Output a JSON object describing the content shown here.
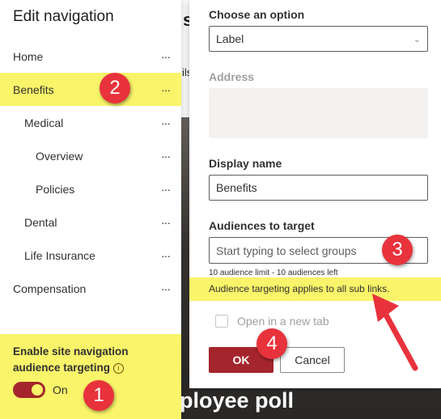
{
  "background": {
    "text_top": "sc",
    "text_mid": "ils",
    "text_bottom": "ployee poll"
  },
  "nav": {
    "title": "Edit navigation",
    "items": [
      {
        "label": "Home",
        "level": 0
      },
      {
        "label": "Benefits",
        "level": 0
      },
      {
        "label": "Medical",
        "level": 1
      },
      {
        "label": "Overview",
        "level": 2
      },
      {
        "label": "Policies",
        "level": 2
      },
      {
        "label": "Dental",
        "level": 1
      },
      {
        "label": "Life Insurance",
        "level": 1
      },
      {
        "label": "Compensation",
        "level": 0
      }
    ],
    "more": "···",
    "targeting_label": "Enable site navigation audience targeting",
    "info_icon": "i",
    "toggle_state": "On",
    "toggle_on": true
  },
  "panel": {
    "choose_label": "Choose an option",
    "choose_value": "Label",
    "address_label": "Address",
    "display_label": "Display name",
    "display_value": "Benefits",
    "audiences_label": "Audiences to target",
    "audiences_placeholder": "Start typing to select groups",
    "audience_limit": "10 audience limit - 10 audiences left",
    "note": "Audience targeting applies to all sub links.",
    "new_tab_label": "Open in a new tab",
    "ok": "OK",
    "cancel": "Cancel"
  },
  "badges": [
    "1",
    "2",
    "3",
    "4"
  ],
  "colors": {
    "highlight": "#f9f46a",
    "accent": "#a4262c",
    "badge": "#e8323c"
  }
}
